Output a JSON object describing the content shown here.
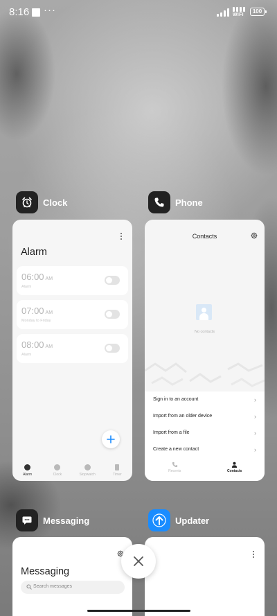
{
  "status_bar": {
    "time": "8:16",
    "overflow_dots": "···",
    "network_label": "WiFi",
    "battery": "100"
  },
  "apps": [
    {
      "name": "Clock",
      "icon": "alarm-clock-icon",
      "screen": {
        "title": "Alarm",
        "alarms": [
          {
            "time": "06:00",
            "ampm": "AM",
            "label": "Alarm",
            "enabled": false
          },
          {
            "time": "07:00",
            "ampm": "AM",
            "label": "Monday to Friday",
            "enabled": false
          },
          {
            "time": "08:00",
            "ampm": "AM",
            "label": "Alarm",
            "enabled": false
          }
        ],
        "tabs": [
          "Alarm",
          "Clock",
          "Stopwatch",
          "Timer"
        ],
        "active_tab": "Alarm"
      }
    },
    {
      "name": "Phone",
      "icon": "phone-icon",
      "screen": {
        "title": "Contacts",
        "empty_text": "No contacts",
        "menu": [
          "Sign in to an account",
          "Import from an older device",
          "Import from a file",
          "Create a new contact"
        ],
        "tabs": [
          "Recents",
          "Contacts"
        ],
        "active_tab": "Contacts"
      }
    },
    {
      "name": "Messaging",
      "icon": "message-icon",
      "screen": {
        "title": "Messaging",
        "search_placeholder": "Search messages"
      }
    },
    {
      "name": "Updater",
      "icon": "upload-arrow-icon",
      "screen": {}
    }
  ],
  "colors": {
    "app_icon_dark": "#222222",
    "updater_icon": "#1a8cff",
    "fab_plus": "#1a8cff"
  }
}
